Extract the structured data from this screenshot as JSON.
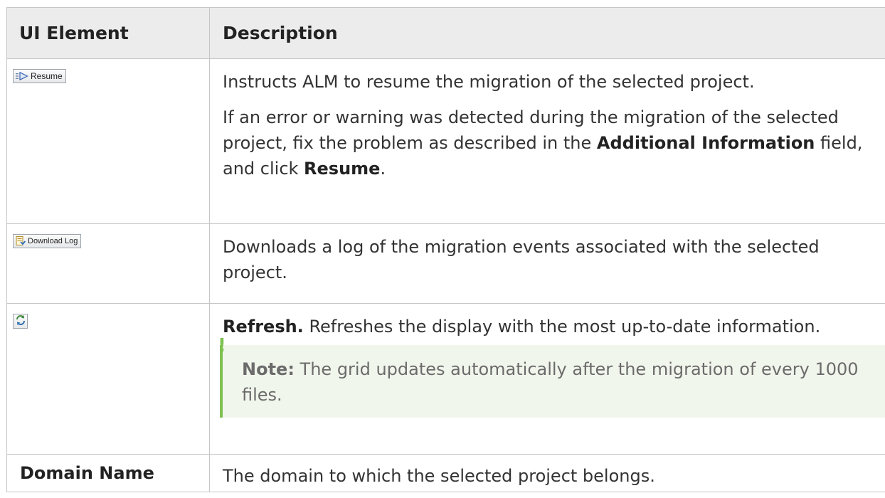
{
  "header": {
    "col1": "UI Element",
    "col2": "Description"
  },
  "rows": [
    {
      "button_label": "Resume",
      "icon": "resume-icon",
      "desc_p1": "Instructs ALM to resume the migration of the selected project.",
      "desc_p2_a": "If an error or warning was detected during the migration of the selected project, fix the problem as described in the ",
      "desc_p2_b1": "Additional Information",
      "desc_p2_c": " field, and click ",
      "desc_p2_b2": "Resume",
      "desc_p2_d": "."
    },
    {
      "button_label": "Download Log",
      "icon": "download-log-icon",
      "desc": "Downloads a log of the migration events associated with the selected project."
    },
    {
      "icon": "refresh-icon",
      "desc_bold": "Refresh.",
      "desc": " Refreshes the display with the most up-to-date information.",
      "note_label": "Note:",
      "note_text": " The grid updates automatically after the migration of every 1000 files."
    },
    {
      "element": "Domain Name",
      "desc": "The domain to which the selected project belongs."
    }
  ],
  "colors": {
    "header_bg": "#ececec",
    "border": "#c6c6c6",
    "note_bg": "#f1f6ec",
    "note_accent": "#7ec150"
  }
}
